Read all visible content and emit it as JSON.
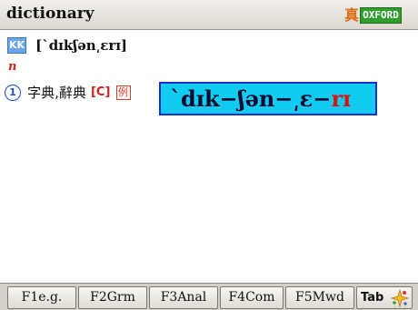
{
  "header": {
    "title": "dictionary",
    "zhen_icon": "真",
    "dictionary_badge": "OXFORD",
    "colors": {
      "badge_green": "#2f9e2f",
      "zhen_orange": "#e06a10"
    }
  },
  "entry": {
    "pronunciation_badge": "KK",
    "pronunciation": "[ˋdɪkʃən͵ɛrɪ]",
    "part_of_speech": "n",
    "senses": [
      {
        "number": "1",
        "definition": "字典,辭典",
        "grammar_tag": "[C]",
        "example_icon": "例"
      }
    ]
  },
  "syllable_popup": {
    "syllables_main": "ˋdɪk−ʃən−͵ɛ−",
    "syllable_last": "rɪ",
    "colors": {
      "background": "#11ccf0",
      "border": "#1a2fd0",
      "highlight": "#e01010"
    }
  },
  "toolbar": {
    "keys": [
      {
        "label": "F1e.g."
      },
      {
        "label": "F2Grm"
      },
      {
        "label": "F3Anal"
      },
      {
        "label": "F4Com"
      },
      {
        "label": "F5Mwd"
      }
    ],
    "tab_label": "Tab",
    "tab_icon": "sparkle-icon"
  }
}
